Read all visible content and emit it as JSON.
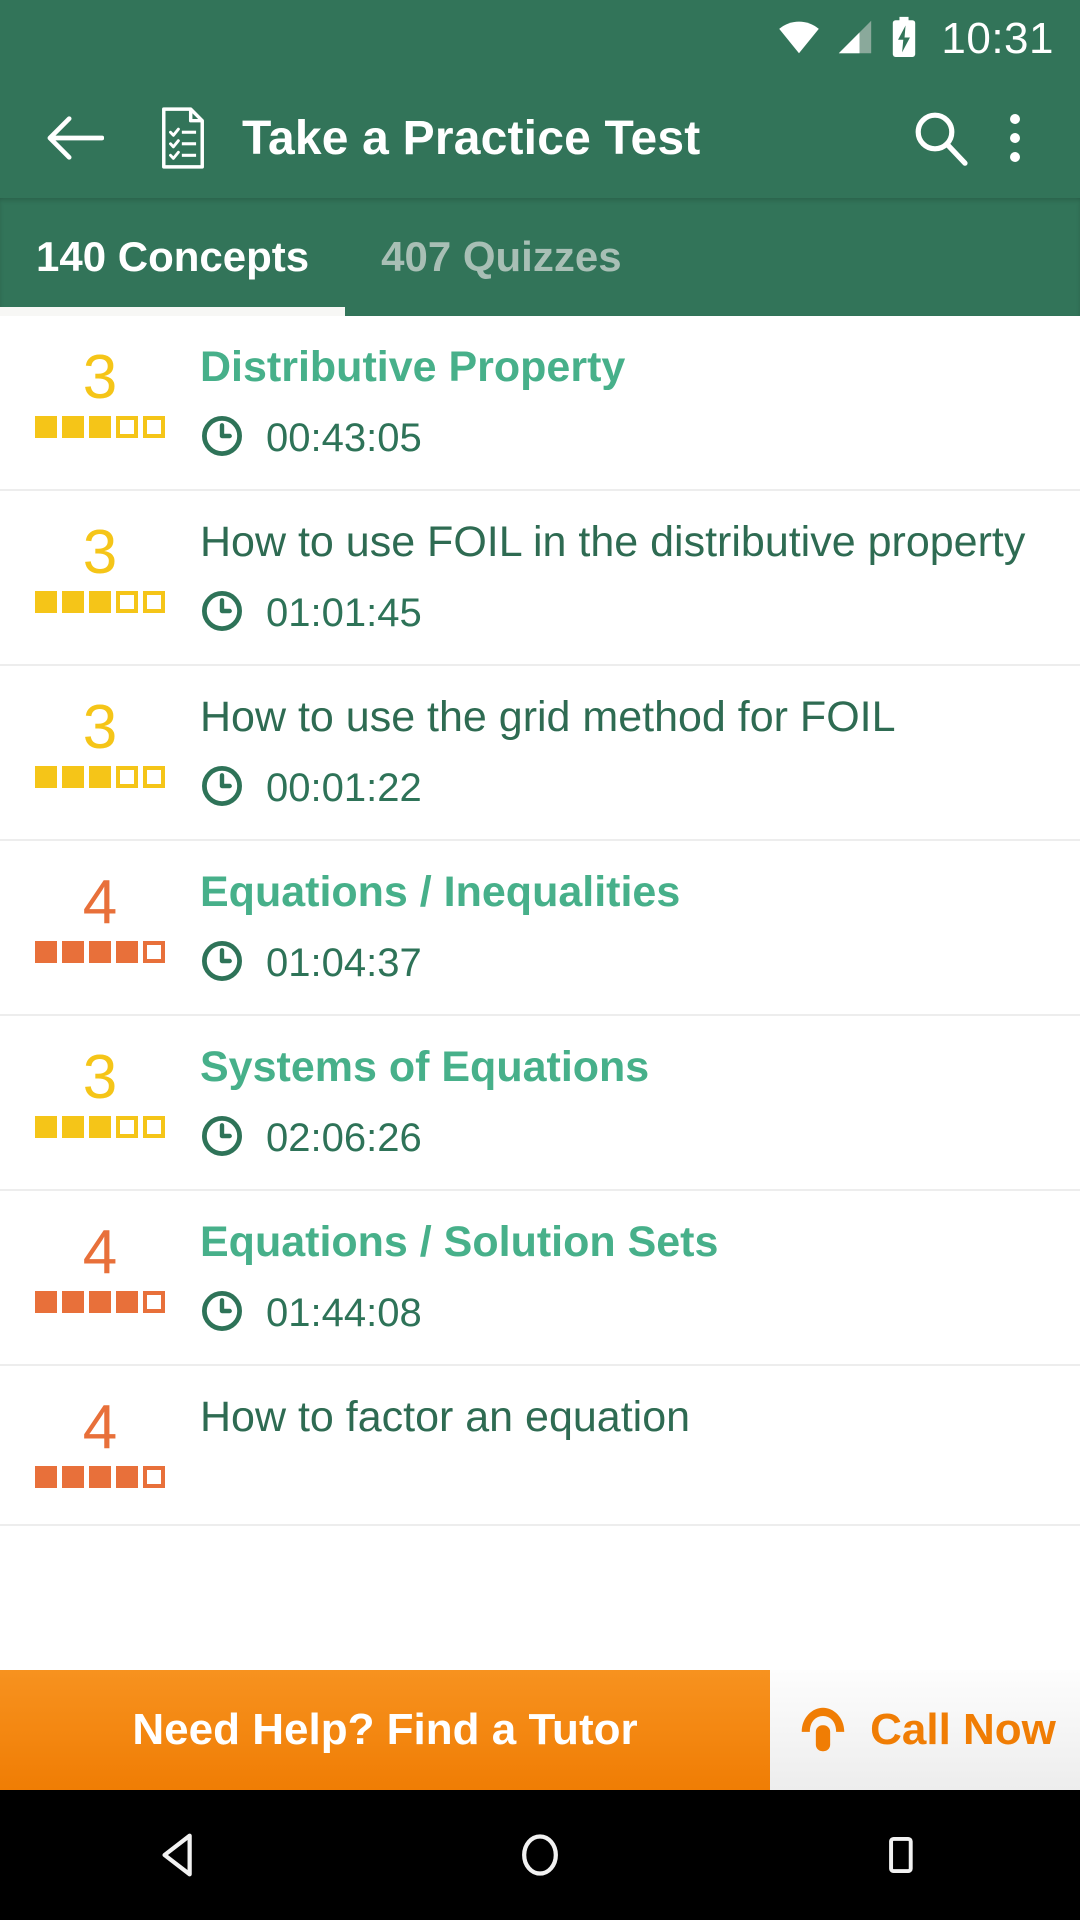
{
  "status_bar": {
    "time": "10:31",
    "icons": [
      "wifi-icon",
      "cellular-signal-icon",
      "battery-charging-icon"
    ]
  },
  "app_bar": {
    "back_icon": "back-arrow-icon",
    "doc_icon": "checklist-document-icon",
    "title": "Take a Practice Test",
    "search_icon": "search-icon",
    "overflow_icon": "more-vertical-icon"
  },
  "tabs": [
    {
      "label": "140 Concepts",
      "active": true
    },
    {
      "label": "407 Quizzes",
      "active": false
    }
  ],
  "colors": {
    "primary_green": "#327459",
    "concept_green": "#47b08a",
    "lesson_green": "#2e6b52",
    "time_green": "#2e7358",
    "rating_yellow": "#f5c518",
    "rating_orange": "#e8703a",
    "banner_orange": "#f58410",
    "tab_inactive": "#a8bfb5"
  },
  "list": {
    "rows": [
      {
        "rating": "3",
        "rating_level": "yellow",
        "filled": 3,
        "total": 5,
        "title": "Distributive Property",
        "type": "concept",
        "time": "00:43:05",
        "clock_icon": "clock-icon"
      },
      {
        "rating": "3",
        "rating_level": "yellow",
        "filled": 3,
        "total": 5,
        "title": "How to use FOIL in the distributive property",
        "type": "lesson",
        "time": "01:01:45",
        "clock_icon": "clock-icon"
      },
      {
        "rating": "3",
        "rating_level": "yellow",
        "filled": 3,
        "total": 5,
        "title": "How to use the grid method for FOIL",
        "type": "lesson",
        "time": "00:01:22",
        "clock_icon": "clock-icon"
      },
      {
        "rating": "4",
        "rating_level": "orange",
        "filled": 4,
        "total": 5,
        "title": "Equations / Inequalities",
        "type": "concept",
        "time": "01:04:37",
        "clock_icon": "clock-icon"
      },
      {
        "rating": "3",
        "rating_level": "yellow",
        "filled": 3,
        "total": 5,
        "title": "Systems of Equations",
        "type": "concept",
        "time": "02:06:26",
        "clock_icon": "clock-icon"
      },
      {
        "rating": "4",
        "rating_level": "orange",
        "filled": 4,
        "total": 5,
        "title": "Equations / Solution Sets",
        "type": "concept",
        "time": "01:44:08",
        "clock_icon": "clock-icon"
      },
      {
        "rating": "4",
        "rating_level": "orange",
        "filled": 4,
        "total": 5,
        "title": "How to factor an equation",
        "type": "lesson",
        "time": "",
        "clock_icon": "clock-icon"
      }
    ]
  },
  "banner": {
    "text": "Need Help? Find a Tutor",
    "call_text": "Call Now",
    "phone_icon": "phone-icon"
  },
  "nav_bar": {
    "back_icon": "nav-back-triangle-icon",
    "home_icon": "nav-home-circle-icon",
    "recents_icon": "nav-recents-square-icon"
  }
}
